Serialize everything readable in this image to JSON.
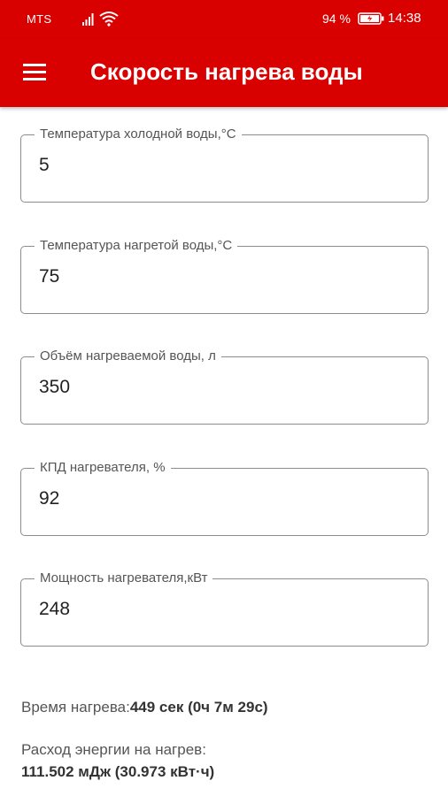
{
  "status_bar": {
    "carrier": "MTS",
    "battery_percent": "94 %",
    "time": "14:38"
  },
  "app_bar": {
    "title": "Скорость нагрева воды",
    "menu_icon": "hamburger-menu-icon"
  },
  "fields": [
    {
      "label": "Температура холодной воды,°С",
      "value": "5"
    },
    {
      "label": "Температура нагретой воды,°С",
      "value": "75"
    },
    {
      "label": "Объём нагреваемой воды, л",
      "value": "350"
    },
    {
      "label": "КПД нагревателя, %",
      "value": "92"
    },
    {
      "label": "Мощность нагревателя,кВт",
      "value": "248"
    }
  ],
  "results": {
    "time_label": "Время нагрева:",
    "time_value": "449 сек (0ч 7м 29с)",
    "energy_label": "Расход энергии на нагрев:",
    "energy_value": "111.502 мДж (30.973 кВт·ч)"
  },
  "colors": {
    "primary": "#d90000",
    "outline": "#8c8c8c"
  }
}
